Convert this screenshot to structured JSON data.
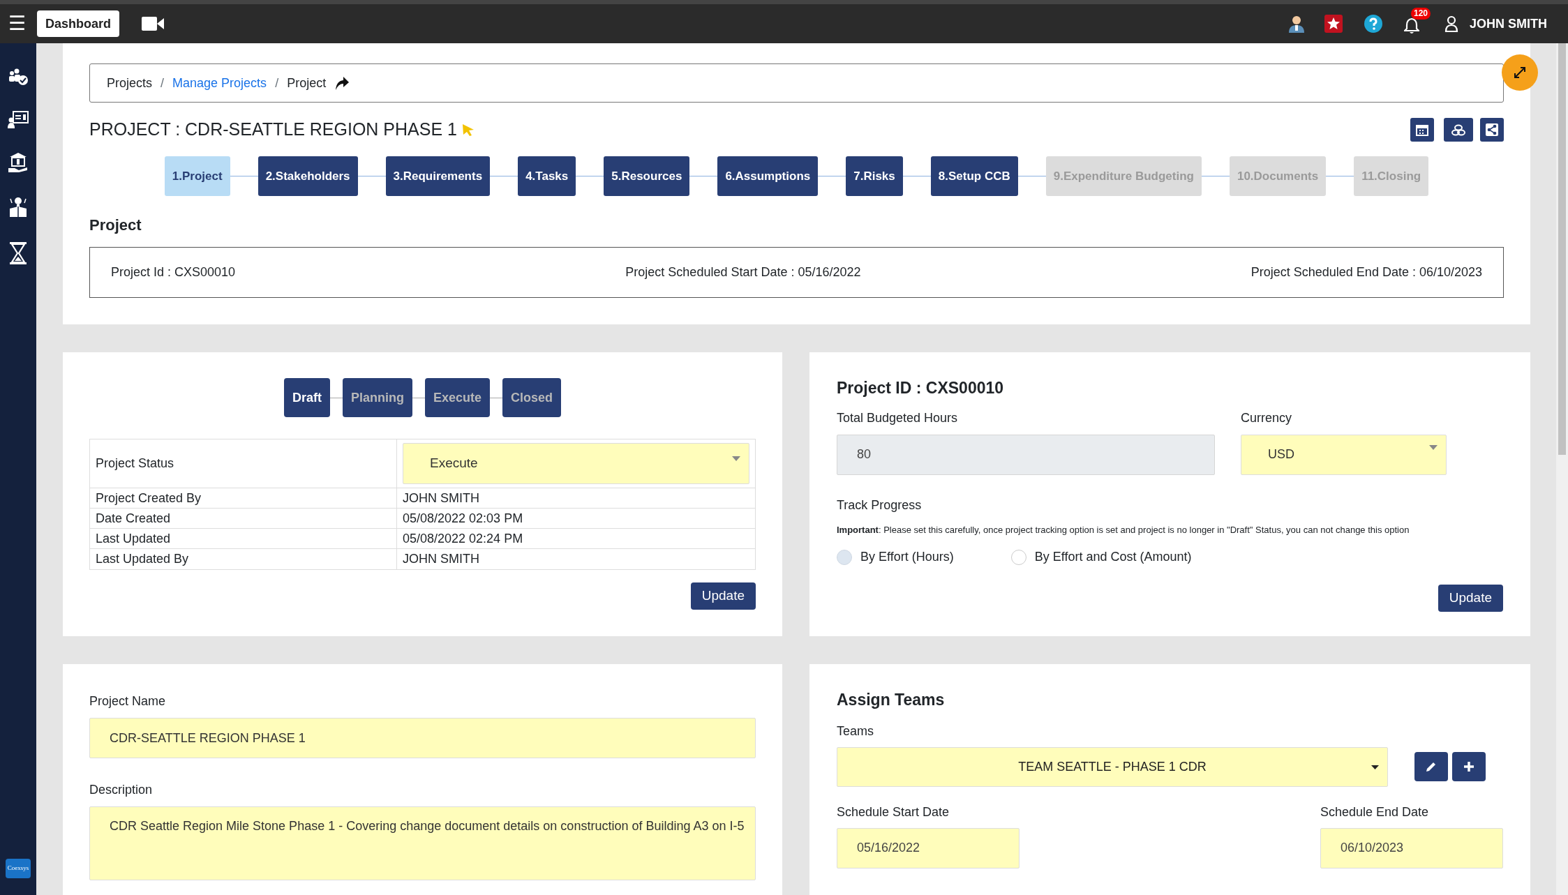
{
  "top_bar": {
    "menu_icon": "☰",
    "dashboard_button": "Dashboard",
    "notification_count": "120",
    "user_name": "JOHN SMITH"
  },
  "sidebar": {
    "logo": "Coexsys"
  },
  "breadcrumb": [
    {
      "label": "Projects",
      "link": false
    },
    {
      "separator": "/",
      "label": "Manage Projects",
      "link": true
    },
    {
      "separator": "/",
      "label": "Project",
      "link": false
    }
  ],
  "title": "PROJECT : CDR-SEATTLE REGION PHASE 1",
  "steps": [
    {
      "label": "1.Project",
      "selected": true,
      "disabled": false
    },
    {
      "label": "2.Stakeholders",
      "selected": false,
      "disabled": false
    },
    {
      "label": "3.Requirements",
      "selected": false,
      "disabled": false
    },
    {
      "label": "4.Tasks",
      "selected": false,
      "disabled": false
    },
    {
      "label": "5.Resources",
      "selected": false,
      "disabled": false
    },
    {
      "label": "6.Assumptions",
      "selected": false,
      "disabled": false
    },
    {
      "label": "7.Risks",
      "selected": false,
      "disabled": false
    },
    {
      "label": "8.Setup CCB",
      "selected": false,
      "disabled": false
    },
    {
      "label": "9.Expenditure Budgeting",
      "selected": false,
      "disabled": true
    },
    {
      "label": "10.Documents",
      "selected": false,
      "disabled": true
    },
    {
      "label": "11.Closing",
      "selected": false,
      "disabled": true
    }
  ],
  "project_section": {
    "heading": "Project",
    "project_id": "Project Id : CXS00010",
    "start_date": "Project Scheduled Start Date : 05/16/2022",
    "end_date": "Project Scheduled End Date : 06/10/2023"
  },
  "status_card": {
    "stages": [
      {
        "label": "Draft",
        "selected": true
      },
      {
        "label": "Planning",
        "selected": false
      },
      {
        "label": "Execute",
        "selected": false
      },
      {
        "label": "Closed",
        "selected": false
      }
    ],
    "rows": [
      {
        "label": "Project Status",
        "kind": "select",
        "value": "Execute"
      },
      {
        "label": "Project Created By",
        "kind": "text",
        "value": "JOHN SMITH"
      },
      {
        "label": "Date Created",
        "kind": "text",
        "value": "05/08/2022 02:03 PM"
      },
      {
        "label": "Last Updated",
        "kind": "text",
        "value": "05/08/2022 02:24 PM"
      },
      {
        "label": "Last Updated By",
        "kind": "text",
        "value": "JOHN SMITH"
      }
    ],
    "update_button": "Update"
  },
  "budget_card": {
    "heading": "Project ID : CXS00010",
    "hours_label": "Total Budgeted Hours",
    "hours_value": "80",
    "currency_label": "Currency",
    "currency_value": "USD",
    "track_label": "Track Progress",
    "note": "**Important**: Please set this carefully, once project tracking option is set and project is no longer in \"Draft\" Status, you can not change this option",
    "options": [
      {
        "label": "By Effort (Hours)",
        "selected": true
      },
      {
        "label": "By Effort and Cost (Amount)",
        "selected": false
      }
    ],
    "update_button": "Update"
  },
  "name_card": {
    "name_label": "Project Name",
    "name_value": "CDR-SEATTLE REGION PHASE 1",
    "description_label": "Description",
    "description_value": "CDR Seattle Region Mile Stone Phase 1 - Covering change document details on construction of Building A3 on I-5"
  },
  "teams_card": {
    "heading": "Assign Teams",
    "teams_label": "Teams",
    "team_value": "TEAM SEATTLE - PHASE 1 CDR",
    "start_label": "Schedule Start Date",
    "start_value": "05/16/2022",
    "end_label": "Schedule End Date",
    "end_value": "06/10/2023"
  }
}
